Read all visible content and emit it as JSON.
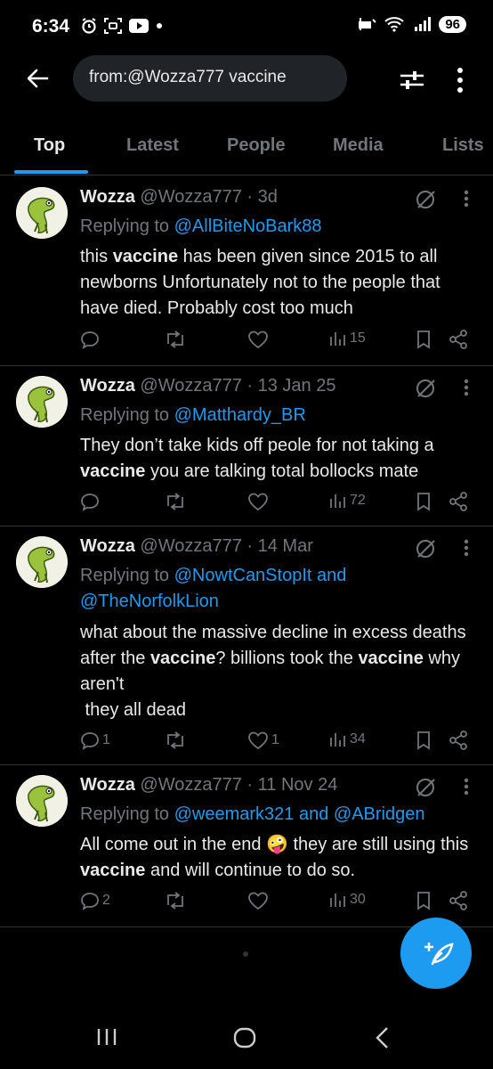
{
  "status": {
    "time": "6:34",
    "battery": "96"
  },
  "search": {
    "query": "from:@Wozza777 vaccine"
  },
  "tabs": [
    "Top",
    "Latest",
    "People",
    "Media",
    "Lists"
  ],
  "tweets": [
    {
      "name": "Wozza",
      "handle": "@Wozza777 · 3d",
      "reply_prefix": "Replying to ",
      "reply_to": "@AllBiteNoBark88",
      "body_html": "this <b>vaccine</b> has been given since 2015 to all newborns Unfortunately not to the people that have died. Probably cost too much",
      "replies": "",
      "likes": "",
      "views": "15"
    },
    {
      "name": "Wozza",
      "handle": "@Wozza777 · 13 Jan 25",
      "reply_prefix": "Replying to ",
      "reply_to": "@Matthardy_BR",
      "body_html": "They don’t take kids off peole for not taking a <b>vaccine</b> you are talking total bollocks mate",
      "replies": "",
      "likes": "",
      "views": "72"
    },
    {
      "name": "Wozza",
      "handle": "@Wozza777 · 14 Mar",
      "reply_prefix": "Replying to ",
      "reply_to": "@NowtCanStopIt and @TheNorfolkLion",
      "body_html": "what about the massive decline in excess deaths after the <b>vaccine</b>? billions took the <b>vaccine</b> why aren't<br>&nbsp;they all dead",
      "replies": "1",
      "likes": "1",
      "views": "34"
    },
    {
      "name": "Wozza",
      "handle": "@Wozza777 · 11 Nov 24",
      "reply_prefix": "Replying to ",
      "reply_to": "@weemark321 and @ABridgen",
      "body_html": "All come out in the end 🤪 they are still using this <b>vaccine</b> and will continue to do so.",
      "replies": "2",
      "likes": "",
      "views": "30"
    }
  ],
  "icons": {
    "back": "arrow-left-icon",
    "filter": "sliders-icon",
    "more": "kebab-icon",
    "reply": "comment-icon",
    "repost": "repost-icon",
    "like": "heart-icon",
    "views": "chart-icon",
    "bookmark": "bookmark-icon",
    "share": "share-icon",
    "compose": "compose-icon"
  },
  "colors": {
    "accent": "#1d9bf0",
    "bg": "#000000",
    "muted": "#71767b"
  }
}
